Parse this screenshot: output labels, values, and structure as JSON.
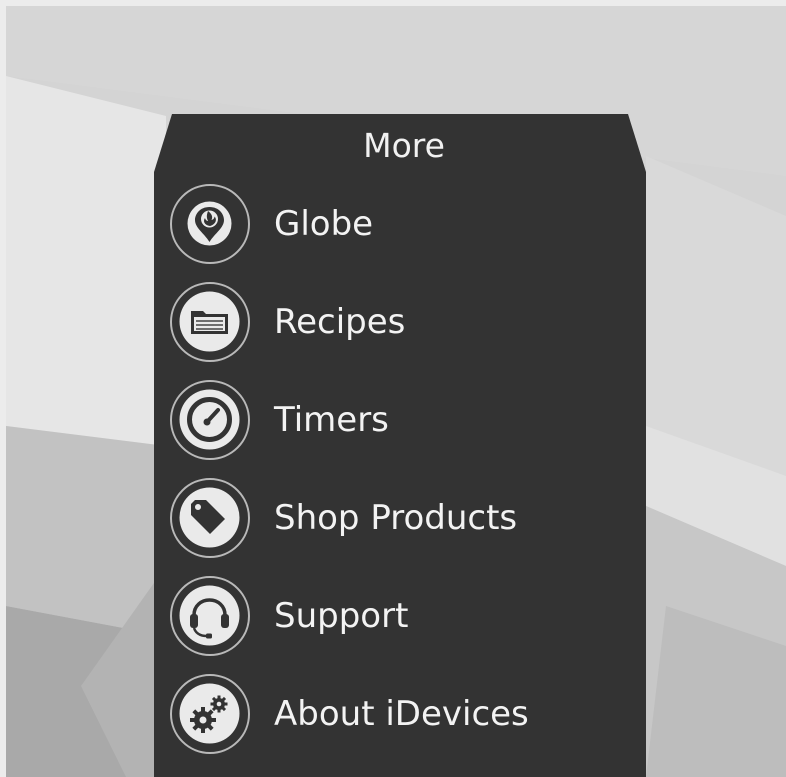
{
  "more_menu": {
    "title": "More",
    "items": [
      {
        "label": "Globe",
        "icon": "map-pin-flame-icon"
      },
      {
        "label": "Recipes",
        "icon": "folder-icon"
      },
      {
        "label": "Timers",
        "icon": "gauge-icon"
      },
      {
        "label": "Shop Products",
        "icon": "price-tag-icon"
      },
      {
        "label": "Support",
        "icon": "headset-icon"
      },
      {
        "label": "About iDevices",
        "icon": "gears-icon"
      }
    ]
  },
  "colors": {
    "panel": "#333333",
    "text": "#f3f3f3",
    "icon_ring": "#b9b9b9",
    "background": "#cfcfcf",
    "page_border": "#ececec"
  }
}
